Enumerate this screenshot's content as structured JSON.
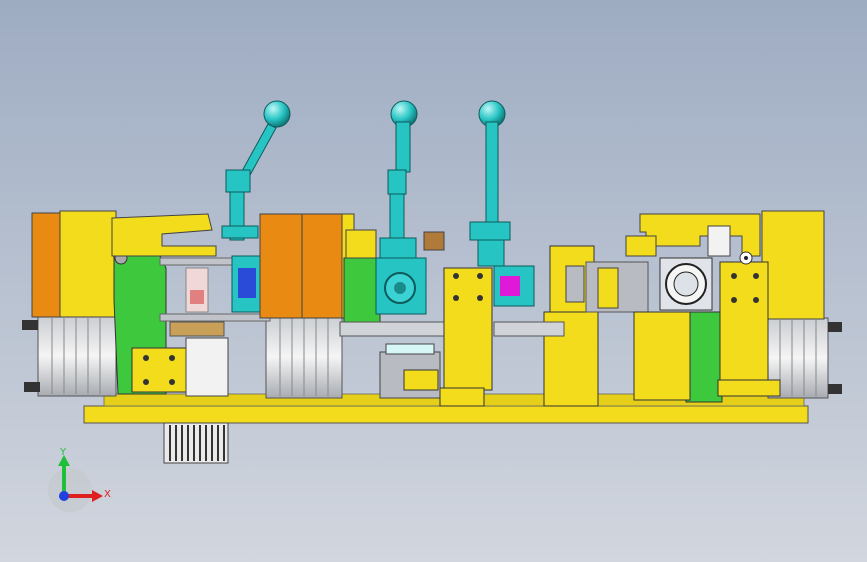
{
  "viewport": {
    "background_top": "#9eacc2",
    "background_bottom": "#d2d6de"
  },
  "model": {
    "palette": {
      "yellow": "#f2dc1c",
      "orange": "#e98a12",
      "green": "#3ec83e",
      "cyan": "#27c4c4",
      "white": "#f2f2f2",
      "magenta": "#e018d8",
      "blue": "#2a4ad8",
      "brown": "#b07a3a",
      "grey": "#b8bcc2",
      "dark": "#333333"
    },
    "handles": [
      "left-handle",
      "center-handle",
      "right-handle"
    ]
  },
  "triad": {
    "y_label": "Y",
    "x_label": "X",
    "y_color": "#1fbf3a",
    "x_color": "#e02020",
    "z_color": "#2040e0"
  }
}
